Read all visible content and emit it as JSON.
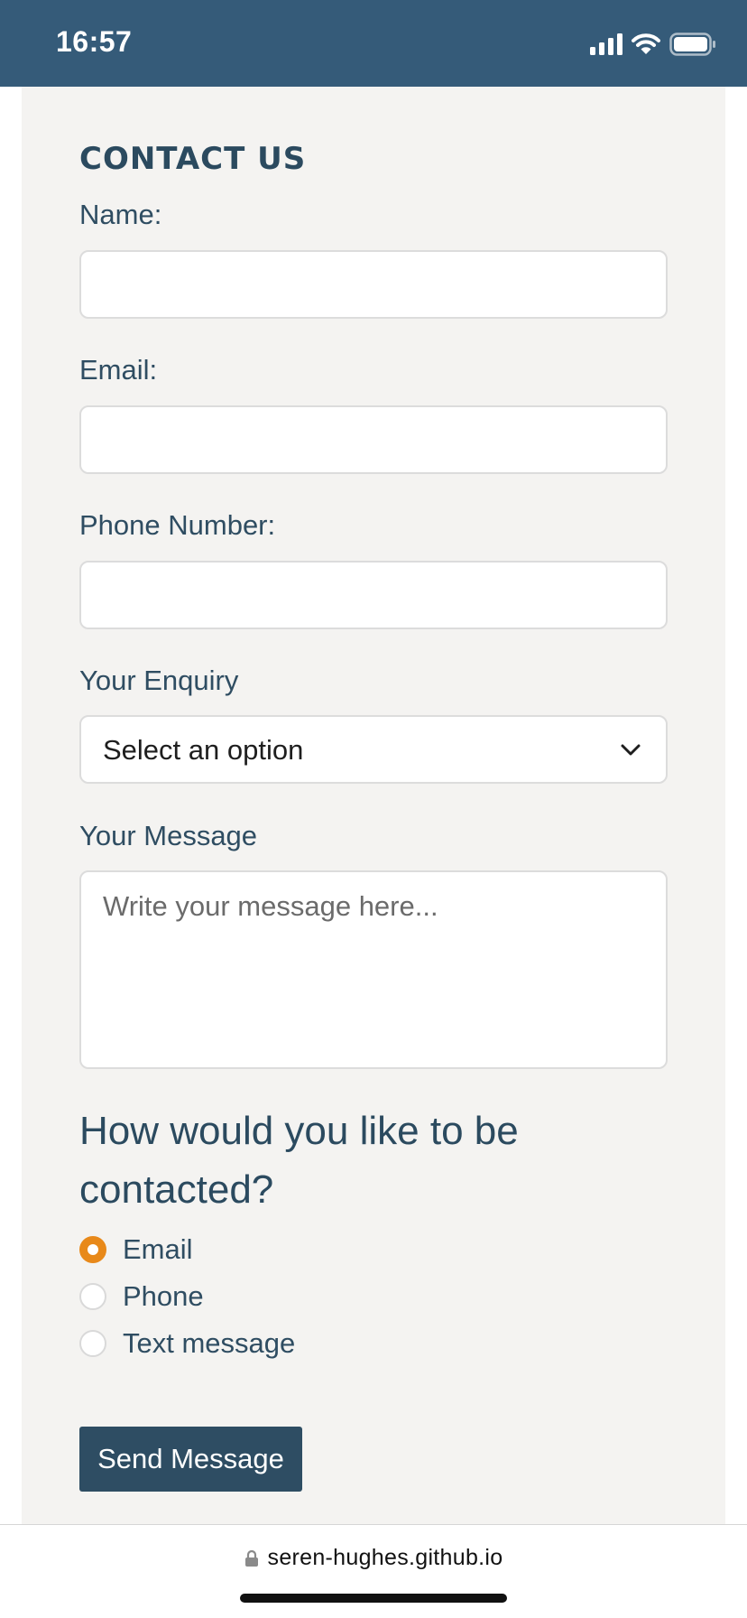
{
  "status_bar": {
    "time": "16:57",
    "icons": [
      "signal-icon",
      "wifi-icon",
      "battery-icon"
    ],
    "background": "#355b79"
  },
  "form": {
    "title": "CONTACT US",
    "fields": {
      "name_label": "Name:",
      "email_label": "Email:",
      "phone_label": "Phone Number:",
      "enquiry_label": "Your Enquiry",
      "enquiry_selected": "Select an option",
      "message_label": "Your Message",
      "message_placeholder": "Write your message here..."
    },
    "contact_question": "How would you like to be contacted?",
    "contact_options": [
      {
        "label": "Email",
        "checked": true
      },
      {
        "label": "Phone",
        "checked": false
      },
      {
        "label": "Text message",
        "checked": false
      }
    ],
    "submit_label": "Send Message"
  },
  "browser": {
    "url": "seren-hughes.github.io",
    "lock_icon": "lock-icon"
  },
  "colors": {
    "accent": "#e8891a",
    "primary": "#2e4d63",
    "page_background": "#f4f3f1"
  }
}
